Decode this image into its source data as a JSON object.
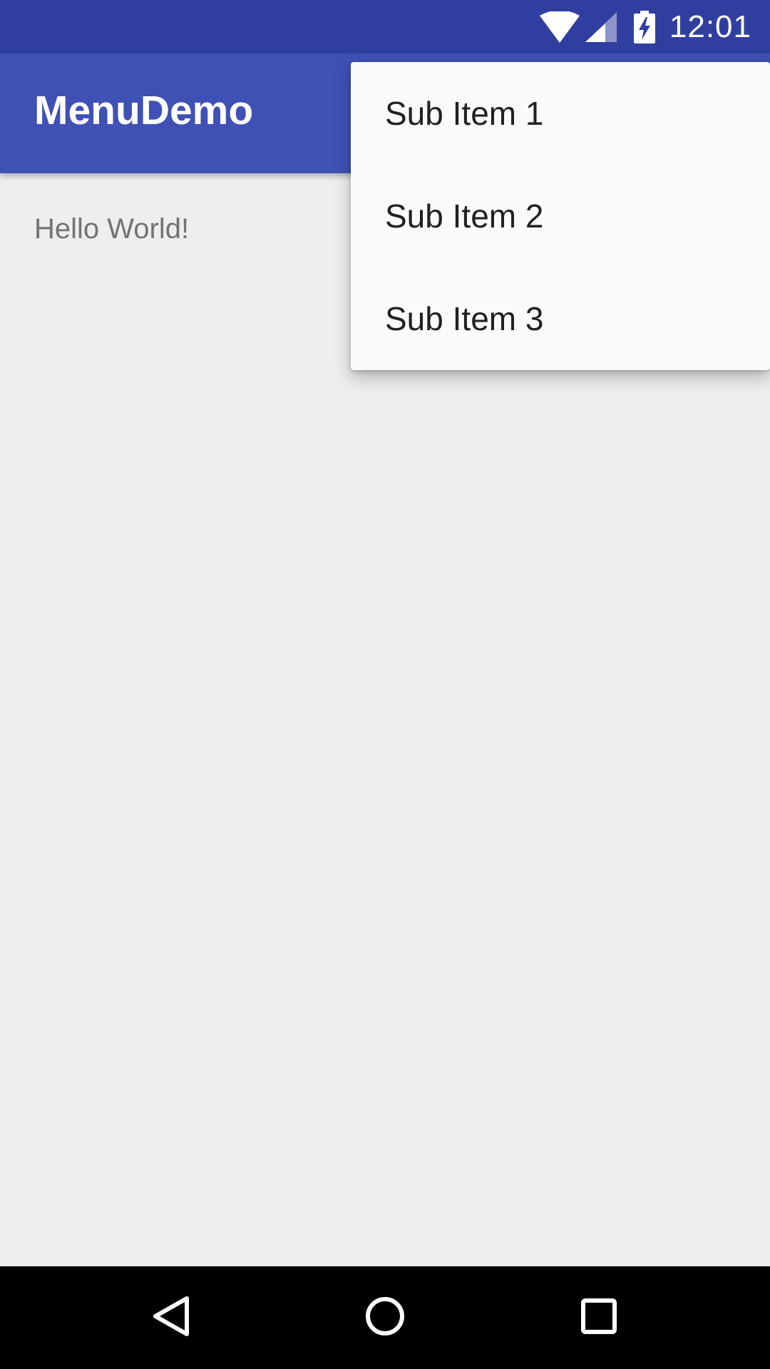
{
  "status_bar": {
    "time": "12:01",
    "icons": [
      "wifi-icon",
      "signal-icon",
      "battery-charging-icon"
    ],
    "color": "#303f9f"
  },
  "app_bar": {
    "title": "MenuDemo",
    "color": "#3f51b5"
  },
  "content": {
    "text": "Hello World!"
  },
  "popup_menu": {
    "items": [
      {
        "label": "Sub Item 1"
      },
      {
        "label": "Sub Item 2"
      },
      {
        "label": "Sub Item 3"
      }
    ]
  },
  "nav_bar": {
    "buttons": [
      "back-icon",
      "home-icon",
      "recents-icon"
    ]
  }
}
